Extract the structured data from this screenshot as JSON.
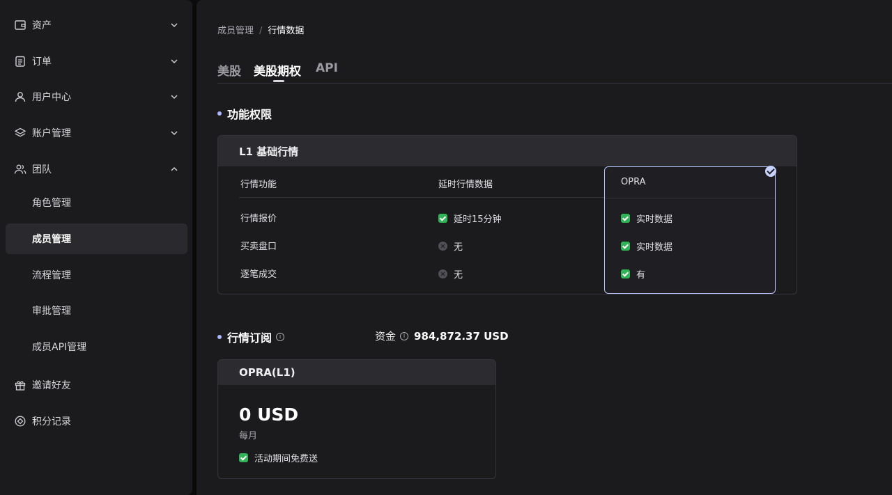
{
  "sidebar": {
    "items": [
      {
        "label": "资产",
        "icon": "wallet-icon",
        "chevron": "down"
      },
      {
        "label": "订单",
        "icon": "clipboard-icon",
        "chevron": "down"
      },
      {
        "label": "用户中心",
        "icon": "user-icon",
        "chevron": "down"
      },
      {
        "label": "账户管理",
        "icon": "layers-icon",
        "chevron": "down"
      },
      {
        "label": "团队",
        "icon": "team-icon",
        "chevron": "up"
      }
    ],
    "team_sub": [
      {
        "label": "角色管理"
      },
      {
        "label": "成员管理",
        "active": true
      },
      {
        "label": "流程管理"
      },
      {
        "label": "审批管理"
      },
      {
        "label": "成员API管理"
      }
    ],
    "bottom": [
      {
        "label": "邀请好友",
        "icon": "gift-icon"
      },
      {
        "label": "积分记录",
        "icon": "points-icon"
      }
    ]
  },
  "breadcrumb": {
    "parent": "成员管理",
    "separator": "/",
    "current": "行情数据"
  },
  "tabs": [
    {
      "label": "美股",
      "active": false
    },
    {
      "label": "美股期权",
      "active": true
    },
    {
      "label": "API",
      "active": false
    }
  ],
  "permissions": {
    "section_title": "功能权限",
    "card_title": "L1 基础行情",
    "headers": {
      "feature": "行情功能",
      "delayed": "延时行情数据",
      "opra": "OPRA"
    },
    "rows": [
      {
        "feature": "行情报价",
        "delayed": "延时15分钟",
        "delayed_ok": true,
        "opra": "实时数据",
        "opra_ok": true
      },
      {
        "feature": "买卖盘口",
        "delayed": "无",
        "delayed_ok": false,
        "opra": "实时数据",
        "opra_ok": true
      },
      {
        "feature": "逐笔成交",
        "delayed": "无",
        "delayed_ok": false,
        "opra": "有",
        "opra_ok": true
      }
    ]
  },
  "subscription": {
    "section_title": "行情订阅",
    "info_icon": "info-icon",
    "funds_label": "资金",
    "funds_value": "984,872.37 USD",
    "plan_title": "OPRA(L1)",
    "price": "0 USD",
    "period": "每月",
    "promo": "活动期间免费送"
  },
  "colors": {
    "accent": "#aab7ff",
    "success": "#33b357",
    "selected_border": "#b6c6ff"
  }
}
